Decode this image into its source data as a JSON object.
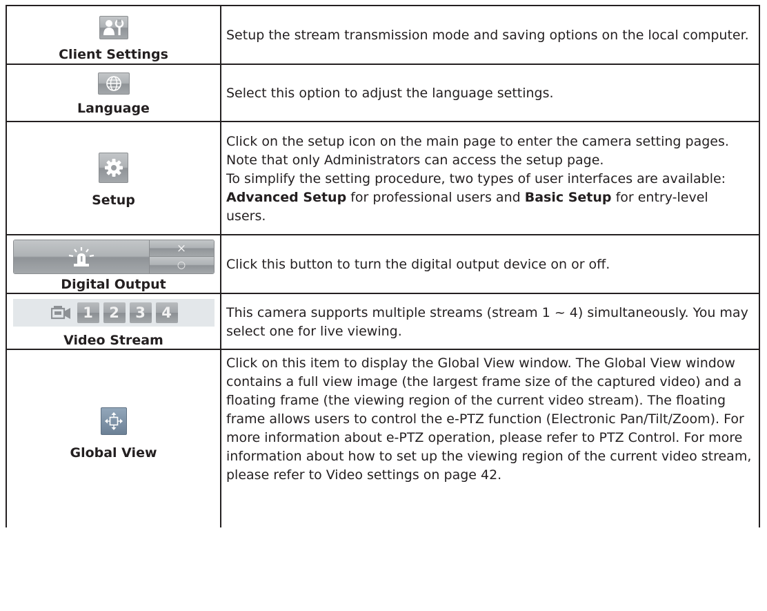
{
  "rows": [
    {
      "label": "Client Settings",
      "icon": "client-settings-icon",
      "desc": "Setup the stream transmission mode and saving options on the local computer."
    },
    {
      "label": "Language",
      "icon": "globe-icon",
      "desc": "Select this option to adjust the language settings."
    },
    {
      "label": "Setup",
      "icon": "gear-icon",
      "desc_part1": "Click on the setup icon on the main page to enter the camera setting pages. Note that only Administrators can access the setup page.",
      "desc_part2": "To simplify the setting procedure, two types of user interfaces are available: ",
      "desc_bold1": "Advanced Setup",
      "desc_part3": " for professional users and ",
      "desc_bold2": "Basic Setup",
      "desc_part4": " for entry-level users."
    },
    {
      "label": "Digital Output",
      "icon": "alarm-light-icon",
      "off_symbol": "×",
      "on_symbol": "○",
      "desc": "Click this button to turn the digital output device on or off."
    },
    {
      "label": "Video Stream",
      "icon": "camera-icon",
      "streams": [
        "1",
        "2",
        "3",
        "4"
      ],
      "desc": "This camera supports multiple streams (stream 1 ~ 4) simultaneously. You may select one for live viewing."
    },
    {
      "label": "Global View",
      "icon": "global-view-icon",
      "desc": "Click on this item to display the Global View window. The Global View window contains a full view image (the largest frame size of the captured video) and a floating frame (the viewing region of the current video stream). The floating frame allows users to control the e-PTZ function (Electronic Pan/Tilt/Zoom). For more information about e-PTZ operation, please refer to PTZ Control. For more information about how to set up the viewing region of the current video stream, please refer to Video settings on page 42."
    }
  ]
}
